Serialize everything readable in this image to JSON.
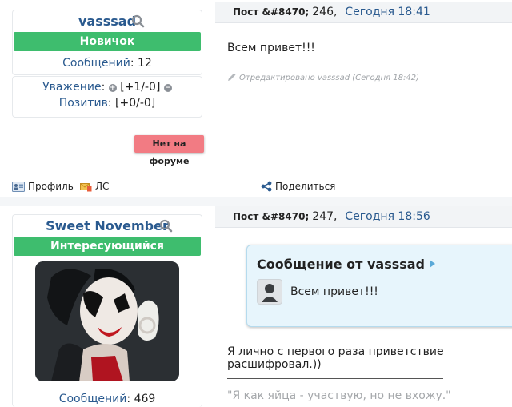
{
  "posts": [
    {
      "author": {
        "name": "vasssad",
        "rank": "Новичок",
        "messages_label": "Сообщений",
        "messages_value": "12"
      },
      "reputation": {
        "label": "Уважение",
        "value": "[+1/-0]",
        "positive_label": "Позитив",
        "positive_value": "[+0/-0]"
      },
      "status": "Нет на форуме",
      "header": {
        "post_label": "Пост &#8470;",
        "number": "246,",
        "date": "Сегодня 18:41"
      },
      "body": "Всем привет!!!",
      "edited": "Отредактировано vasssad (Сегодня 18:42)",
      "footer": {
        "profile": "Профиль",
        "pm": "ЛС",
        "share": "Поделиться"
      }
    },
    {
      "author": {
        "name": "Sweet November",
        "rank": "Интересующийся",
        "messages_label": "Сообщений",
        "messages_value": "469"
      },
      "header": {
        "post_label": "Пост &#8470;",
        "number": "247,",
        "date": "Сегодня 18:56"
      },
      "quote": {
        "title": "Сообщение от vasssad",
        "text": "Всем привет!!!"
      },
      "body": "Я лично с первого раза приветствие расшифровал.))",
      "signature": "\"Я как яйца - участвую, но не вхожу.\""
    }
  ],
  "colors": {
    "accent": "#2a5a8f",
    "rank_green": "#3ebd6e",
    "offline_red": "#f27b83",
    "quote_bg": "#e7f5fc"
  }
}
